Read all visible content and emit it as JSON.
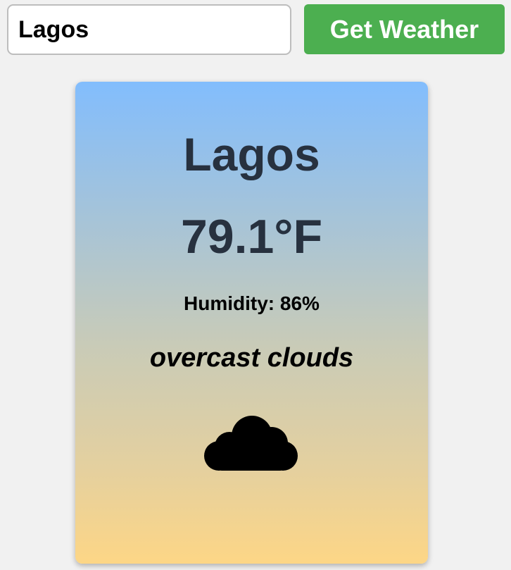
{
  "search": {
    "city_value": "Lagos",
    "placeholder": "",
    "button_label": "Get Weather"
  },
  "weather": {
    "city": "Lagos",
    "temperature": "79.1°F",
    "humidity": "Humidity: 86%",
    "description": "overcast clouds",
    "icon": "cloud-icon"
  },
  "colors": {
    "button_bg": "#4caf50",
    "card_gradient_top": "#82bdfd",
    "card_gradient_bottom": "#fdd686",
    "heading_text": "#27313f"
  }
}
